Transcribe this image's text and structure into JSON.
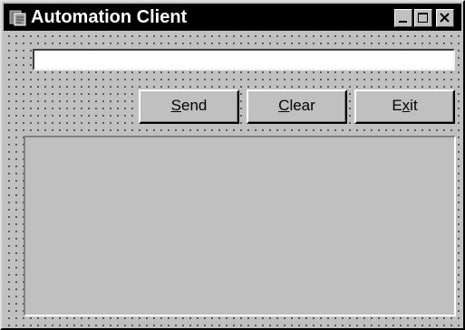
{
  "window": {
    "title": "Automation Client",
    "icon": "application-icon"
  },
  "title_controls": {
    "minimize_icon": "minimize-icon",
    "maximize_icon": "maximize-icon",
    "close_icon": "close-icon"
  },
  "input": {
    "value": "",
    "placeholder": ""
  },
  "buttons": {
    "send": {
      "label": "Send",
      "accel": "S"
    },
    "clear": {
      "label": "Clear",
      "accel": "C"
    },
    "exit": {
      "label": "Exit",
      "accel": "x"
    }
  },
  "output": {
    "text": ""
  },
  "colors": {
    "face": "#c0c0c0",
    "titlebar": "#000000",
    "title_text": "#ffffff"
  }
}
